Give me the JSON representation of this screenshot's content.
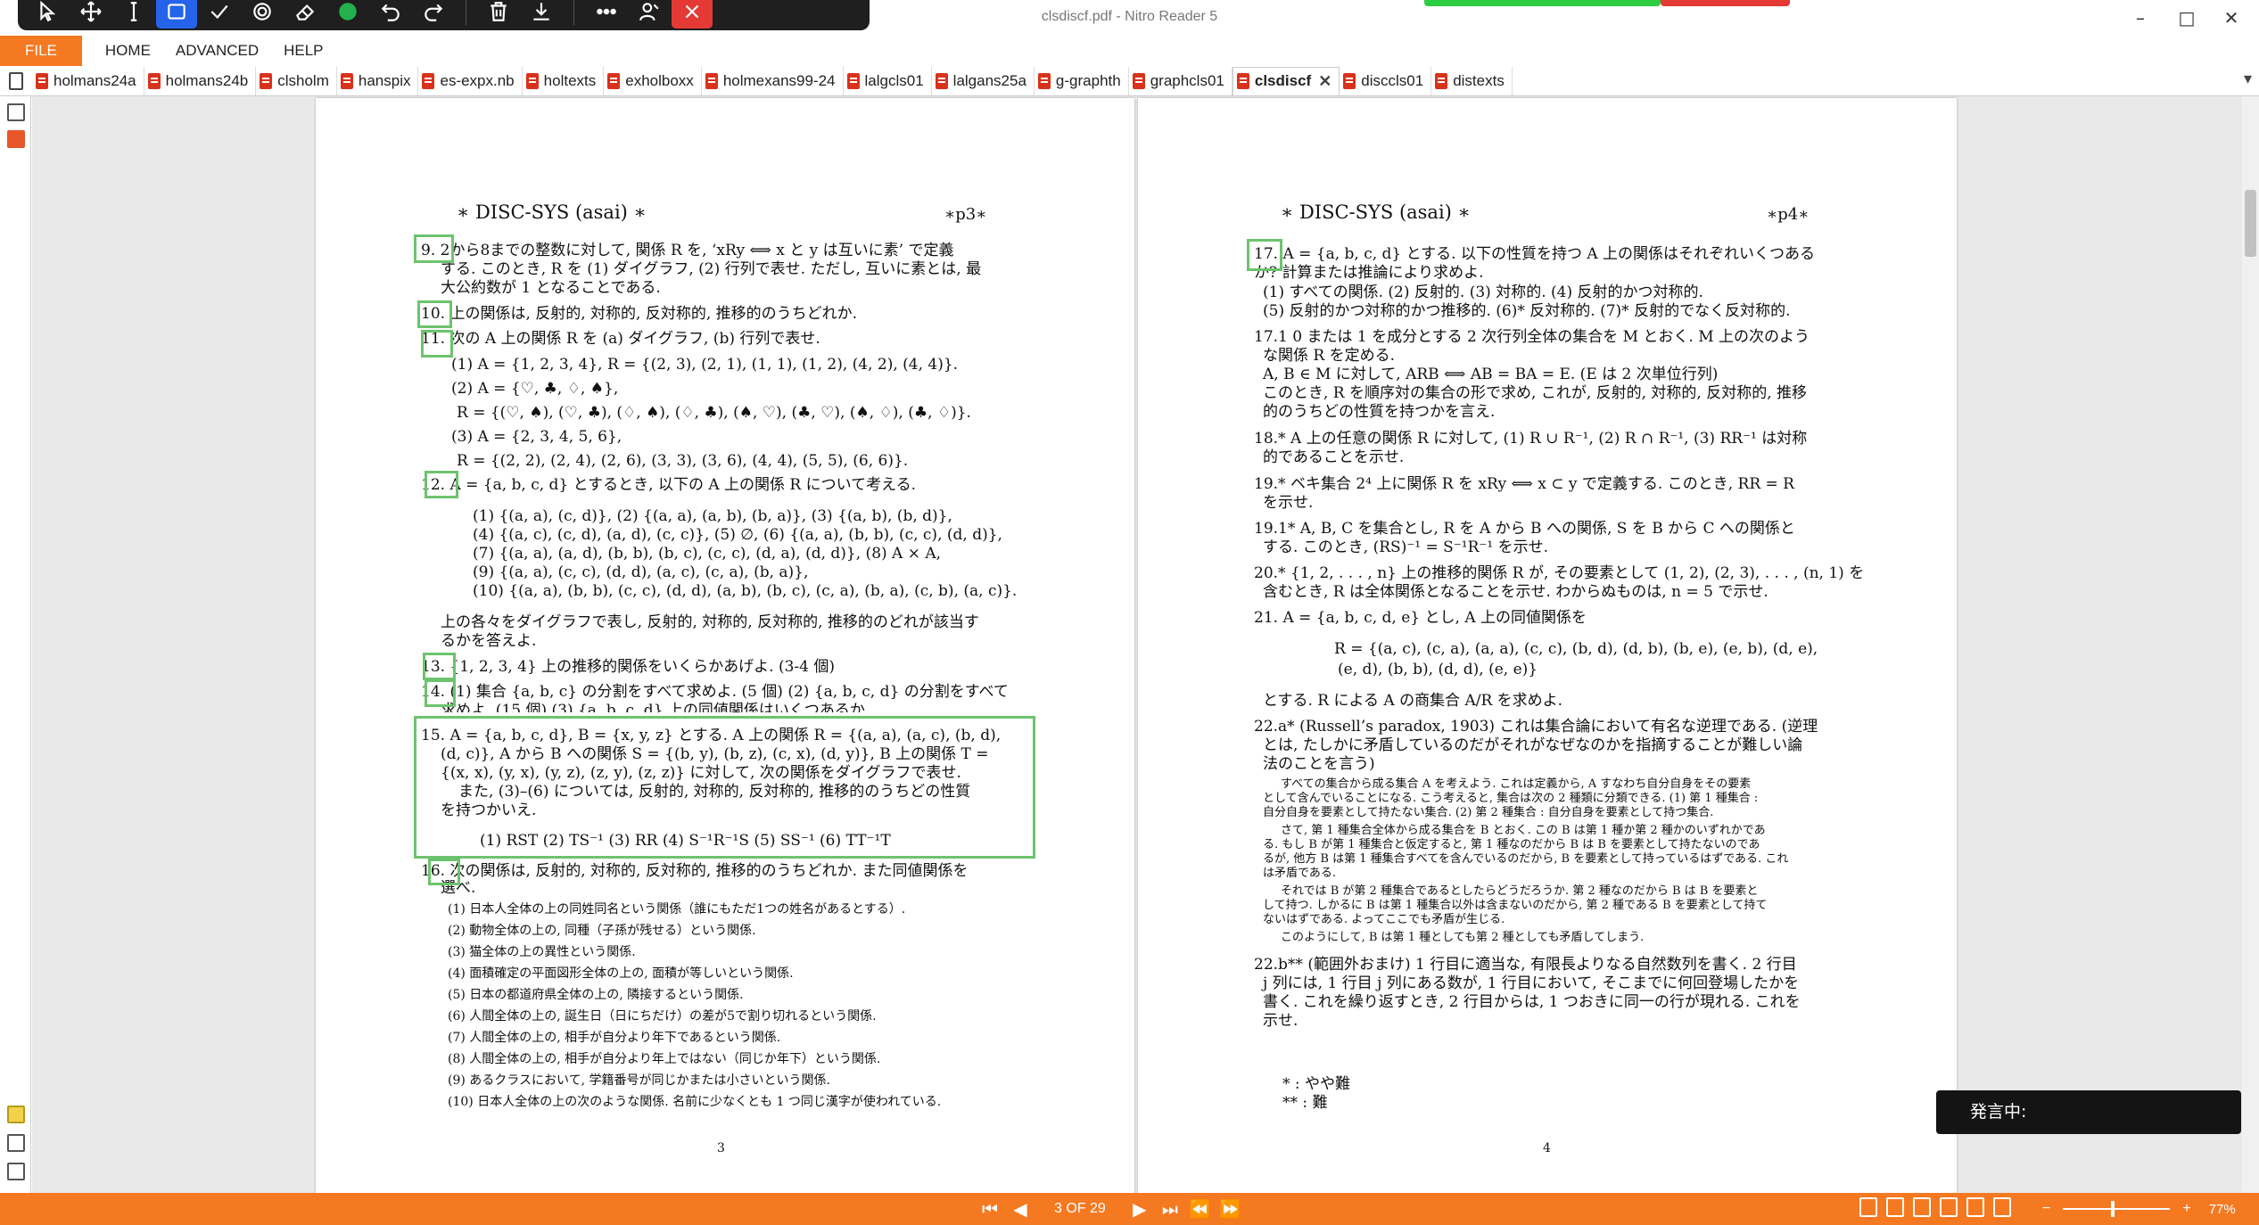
{
  "window": {
    "title": "clsdiscf.pdf - Nitro Reader 5",
    "minimize": "–",
    "maximize": "□",
    "close": "✕"
  },
  "toolbar_icons": [
    "pointer-icon",
    "move-icon",
    "text-cursor-icon",
    "rectangle-icon",
    "check-icon",
    "target-icon",
    "eraser-icon",
    "circle-icon",
    "undo-icon",
    "redo-icon",
    "trash-icon",
    "download-icon",
    "more-icon",
    "person-icon",
    "close-icon"
  ],
  "menu": {
    "file": "FILE",
    "home": "HOME",
    "advanced": "ADVANCED",
    "help": "HELP"
  },
  "tabs": [
    "holmans24a",
    "holmans24b",
    "clsholm",
    "hanspix",
    "es-expx.nb",
    "holtexts",
    "exholboxx",
    "holmexans99-24",
    "lalgcls01",
    "lalgans25a",
    "g-graphth",
    "graphcls01",
    "clsdiscf",
    "disccls01",
    "distexts"
  ],
  "active_tab_close": "✕",
  "tab_overflow": "▾",
  "left_page": {
    "header_left": "∗ DISC-SYS (asai) ∗",
    "header_right": "∗p3∗",
    "lines": [
      "9. 2から8までの整数に対して, 関係 R を, ‘xRy ⟺ x と y は互いに素’ で定義",
      "する. このとき, R を (1) ダイグラフ, (2) 行列で表せ. ただし, 互いに素とは, 最",
      "大公約数が 1 となることである.",
      "10. 上の関係は, 反射的, 対称的, 反対称的, 推移的のうちどれか.",
      "11. 次の A 上の関係 R を (a) ダイグラフ, (b) 行列で表せ.",
      "(1) A = {1, 2, 3, 4}, R = {(2, 3), (2, 1), (1, 1), (1, 2), (4, 2), (4, 4)}.",
      "(2) A = {♡, ♣, ♢, ♠},",
      "R = {(♡, ♠), (♡, ♣), (♢, ♠), (♢, ♣), (♠, ♡), (♣, ♡), (♠, ♢), (♣, ♢)}.",
      "(3) A = {2, 3, 4, 5, 6},",
      "R = {(2, 2), (2, 4), (2, 6), (3, 3), (3, 6), (4, 4), (5, 5), (6, 6)}.",
      "12. A = {a, b, c, d} とするとき, 以下の A 上の関係 R について考える.",
      "(1) {(a, a), (c, d)},   (2) {(a, a), (a, b), (b, a)},   (3) {(a, b), (b, d)},",
      "(4) {(a, c), (c, d), (a, d), (c, c)},   (5) ∅,   (6) {(a, a), (b, b), (c, c), (d, d)},",
      "(7) {(a, a), (a, d), (b, b), (b, c), (c, c), (d, a), (d, d)},   (8) A × A,",
      "(9) {(a, a), (c, c), (d, d), (a, c), (c, a), (b, a)},",
      "(10) {(a, a), (b, b), (c, c), (d, d), (a, b), (b, c), (c, a), (b, a), (c, b), (a, c)}.",
      "上の各々をダイグラフで表し, 反射的, 対称的, 反対称的, 推移的のどれが該当す",
      "るかを答えよ.",
      "13. {1, 2, 3, 4} 上の推移的関係をいくらかあげよ. (3-4 個)",
      "14. (1) 集合 {a, b, c} の分割をすべて求めよ. (5 個) (2) {a, b, c, d} の分割をすべて",
      "求めよ. (15 個) (3) {a, b, c, d} 上の同値関係はいくつあるか.",
      "15. A = {a, b, c, d}, B = {x, y, z} とする. A 上の関係 R = {(a, a), (a, c), (b, d),",
      "(d, c)}, A から B への関係 S = {(b, y), (b, z), (c, x), (d, y)}, B 上の関係 T =",
      "{(x, x), (y, x), (y, z), (z, y), (z, z)} に対して, 次の関係をダイグラフで表せ.",
      "また, (3)–(6) については, 反射的, 対称的, 反対称的, 推移的のうちどの性質",
      "を持つかいえ.",
      "(1) RST   (2) TS⁻¹   (3) RR   (4) S⁻¹R⁻¹S   (5) SS⁻¹   (6) TT⁻¹T",
      "16. 次の関係は, 反射的, 対称的, 反対称的, 推移的のうちどれか. また同値関係を",
      "選べ.",
      "(1) 日本人全体の上の同姓同名という関係（誰にもただ1つの姓名があるとする）.",
      "(2) 動物全体の上の, 同種（子孫が残せる）という関係.",
      "(3) 猫全体の上の異性という関係.",
      "(4) 面積確定の平面図形全体の上の, 面積が等しいという関係.",
      "(5) 日本の都道府県全体の上の, 隣接するという関係.",
      "(6) 人間全体の上の, 誕生日（日にちだけ）の差が5で割り切れるという関係.",
      "(7) 人間全体の上の, 相手が自分より年下であるという関係.",
      "(8) 人間全体の上の, 相手が自分より年上ではない（同じか年下）という関係.",
      "(9) あるクラスにおいて, 学籍番号が同じかまたは小さいという関係.",
      "(10) 日本人全体の上の次のような関係. 名前に少なくとも 1 つ同じ漢字が使われている."
    ],
    "page_number": "3"
  },
  "right_page": {
    "header_left": "∗ DISC-SYS (asai) ∗",
    "header_right": "∗p4∗",
    "lines": [
      "17. A = {a, b, c, d} とする. 以下の性質を持つ A 上の関係はそれぞれいくつある",
      "か? 計算または推論により求めよ.",
      "(1) すべての関係.  (2) 反射的.  (3) 対称的.  (4) 反射的かつ対称的.",
      "(5) 反射的かつ対称的かつ推移的.  (6)* 反対称的.  (7)* 反射的でなく反対称的.",
      "17.1  0 または 1 を成分とする 2 次行列全体の集合を M とおく. M 上の次のよう",
      "な関係 R を定める.",
      "A, B ∈ M に対して, ARB ⟺ AB = BA = E.  (E は 2 次単位行列)",
      "このとき, R を順序対の集合の形で求め, これが, 反射的, 対称的, 反対称的, 推移",
      "的のうちどの性質を持つかを言え.",
      "18.* A 上の任意の関係 R に対して, (1) R ∪ R⁻¹, (2) R ∩ R⁻¹, (3) RR⁻¹ は対称",
      "的であることを示せ.",
      "19.* ベキ集合 2⁴ 上に関係 R を xRy ⟺ x ⊂ y で定義する. このとき, RR = R",
      "を示せ.",
      "19.1* A, B, C を集合とし, R を A から B への関係, S を B から C への関係と",
      "する. このとき, (RS)⁻¹ = S⁻¹R⁻¹ を示せ.",
      "20.* {1, 2, . . . , n} 上の推移的関係 R が, その要素として (1, 2), (2, 3), . . . , (n, 1) を",
      "含むとき, R は全体関係となることを示せ. わからぬものは, n = 5 で示せ.",
      "21. A = {a, b, c, d, e} とし, A 上の同値関係を",
      "R = {(a, c), (c, a), (a, a), (c, c), (b, d), (d, b), (b, e), (e, b), (d, e),",
      "(e, d), (b, b), (d, d), (e, e)}",
      "とする. R による A の商集合 A/R を求めよ.",
      "22.a* (Russell’s paradox, 1903) これは集合論において有名な逆理である. (逆理",
      "とは, たしかに矛盾しているのだがそれがなぜなのかを指摘することが難しい論",
      "法のことを言う)",
      "すべての集合から成る集合 A を考えよう. これは定義から, A すなわち自分自身をその要素",
      "として含んでいることになる. こう考えると, 集合は次の 2 種類に分類できる. (1) 第 1 種集合 :",
      "自分自身を要素として持たない集合. (2) 第 2 種集合 : 自分自身を要素として持つ集合.",
      "さて, 第 1 種集合全体から成る集合を B とおく. この B は第 1 種か第 2 種かのいずれかであ",
      "る. もし B が第 1 種集合と仮定すると, 第 1 種なのだから B は B を要素として持たないのであ",
      "るが, 他方 B は第 1 種集合すべてを含んでいるのだから, B を要素として持っているはずである. これ",
      "は矛盾である.",
      "それでは B が第 2 種集合であるとしたらどうだろうか. 第 2 種なのだから B は B を要素と",
      "して持つ. しかるに B は第 1 種集合以外は含まないのだから, 第 2 種である B を要素として持て",
      "ないはずである. よってここでも矛盾が生じる.",
      "このようにして, B は第 1 種としても第 2 種としても矛盾してしまう.",
      "22.b** (範囲外おまけ) 1 行目に適当な, 有限長よりなる自然数列を書く. 2 行目",
      "j 列には, 1 行目 j 列にある数が, 1 行目において, そこまでに何回登場したかを",
      "書く. これを繰り返すとき, 2 行目からは, 1 つおきに同一の行が現れる. これを",
      "示せ.",
      "* : やや難",
      "** : 難"
    ],
    "page_number": "4"
  },
  "speech_status": "発言中:",
  "status": {
    "page_count": "3 OF 29",
    "zoom": "77%",
    "zoom_fraction": 0.45,
    "zoom_minus": "−",
    "zoom_plus": "+"
  }
}
